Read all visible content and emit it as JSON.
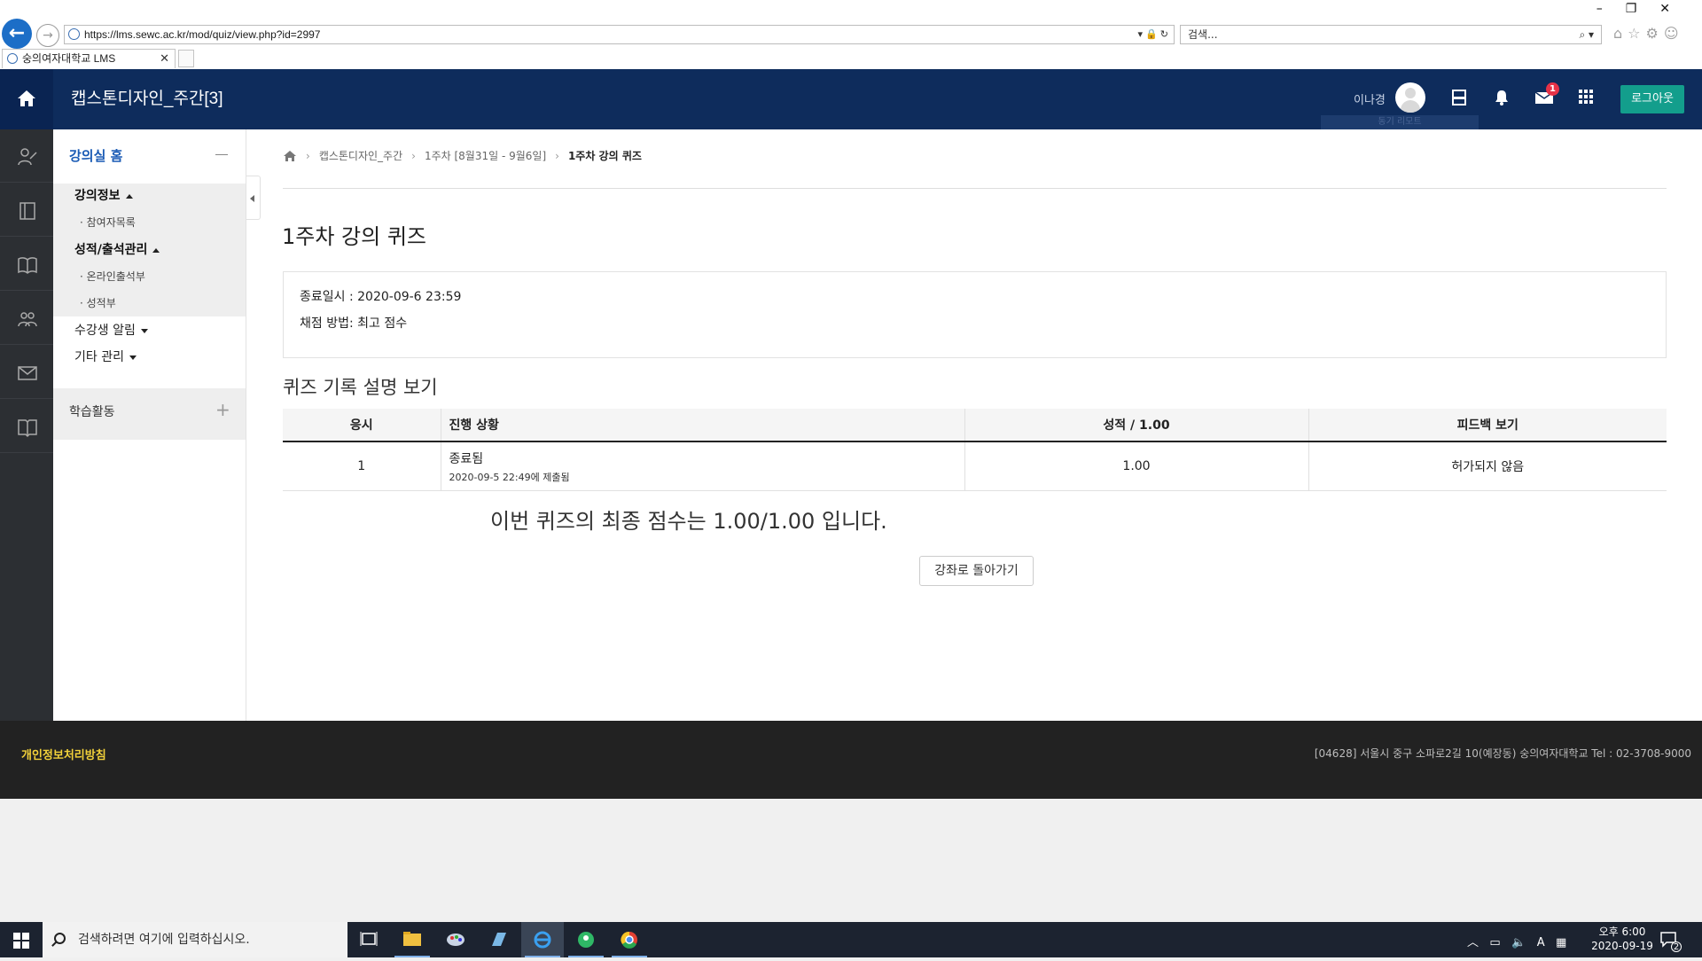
{
  "browser": {
    "url": "https://lms.sewc.ac.kr/mod/quiz/view.php?id=2997",
    "search_placeholder": "검색...",
    "tab_title": "숭의여자대학교 LMS"
  },
  "header": {
    "course_title": "캡스톤디자인_주간[3]",
    "user_name": "이나경",
    "message_badge": "1",
    "logout_label": "로그아웃",
    "hint_strip": "동기 리모트"
  },
  "menu": {
    "home_label": "강의실 홈",
    "sections": [
      {
        "label": "강의정보",
        "items": [
          "참여자목록"
        ]
      },
      {
        "label": "성적/출석관리",
        "items": [
          "온라인출석부",
          "성적부"
        ]
      }
    ],
    "student_alerts": "수강생 알림",
    "other_manage": "기타 관리",
    "activity_label": "학습활동"
  },
  "breadcrumb": {
    "items": [
      "캡스톤디자인_주간",
      "1주차 [8월31일 - 9월6일]",
      "1주차 강의 퀴즈"
    ]
  },
  "quiz": {
    "title": "1주차 강의 퀴즈",
    "close_date": "종료일시 : 2020-09-6 23:59",
    "grading_method": "채점 방법: 최고 점수",
    "history_title": "퀴즈 기록 설명 보기",
    "table": {
      "headers": [
        "응시",
        "진행 상황",
        "성적 / 1.00",
        "피드백 보기"
      ],
      "rows": [
        {
          "attempt": "1",
          "state": "종료됨",
          "submitted": "2020-09-5 22:49에 제출됨",
          "grade": "1.00",
          "feedback": "허가되지 않음"
        }
      ]
    },
    "final_grade": "이번 퀴즈의 최종 점수는 1.00/1.00 입니다.",
    "back_button": "강좌로 돌아가기"
  },
  "footer": {
    "privacy": "개인정보처리방침",
    "address": "[04628] 서울시 중구 소파로2길 10(예장동) 숭의여자대학교   Tel : 02-3708-9000"
  },
  "taskbar": {
    "search_placeholder": "검색하려면 여기에 입력하십시오.",
    "time": "오후 6:00",
    "date": "2020-09-19",
    "notification_count": "2",
    "ime_label": "A"
  }
}
